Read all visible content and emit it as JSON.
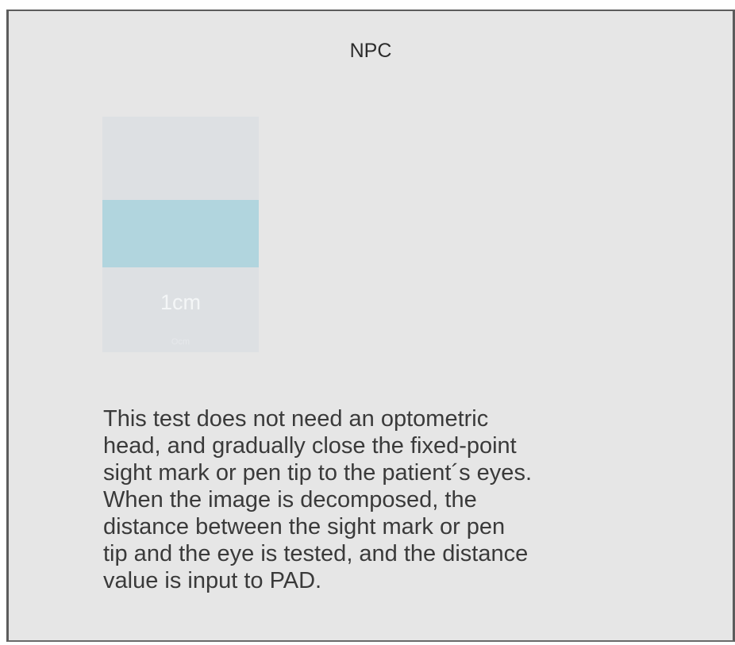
{
  "dialog": {
    "title": "NPC",
    "picker": {
      "selected_value": "1cm",
      "next_value": "Ocm",
      "highlight_color": "#b1d5de"
    },
    "description": "This test does not need an optometric\nhead, and gradually close the fixed-point\nsight mark or pen tip to the patient´s eyes.\nWhen the image is decomposed, the\ndistance between the sight mark or pen\ntip and the eye is tested, and the distance\nvalue is input to PAD."
  }
}
